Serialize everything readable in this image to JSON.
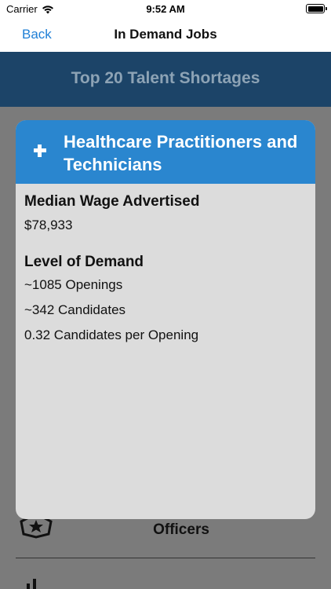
{
  "status_bar": {
    "carrier": "Carrier",
    "time": "9:52 AM"
  },
  "nav": {
    "back_label": "Back",
    "title": "In Demand Jobs"
  },
  "banner": {
    "title": "Top 20 Talent Shortages"
  },
  "background_list": {
    "visible_item_label": "Officers"
  },
  "card": {
    "icon": "plus-icon",
    "title": "Healthcare Practitioners and Technicians",
    "wage_section": {
      "title": "Median Wage Advertised",
      "value": "$78,933"
    },
    "demand_section": {
      "title": "Level of Demand",
      "openings": "~1085 Openings",
      "candidates": "~342 Candidates",
      "ratio": "0.32 Candidates per Opening"
    }
  },
  "colors": {
    "accent": "#2a86cf",
    "banner": "#1c4468",
    "link": "#1f7fd6"
  }
}
